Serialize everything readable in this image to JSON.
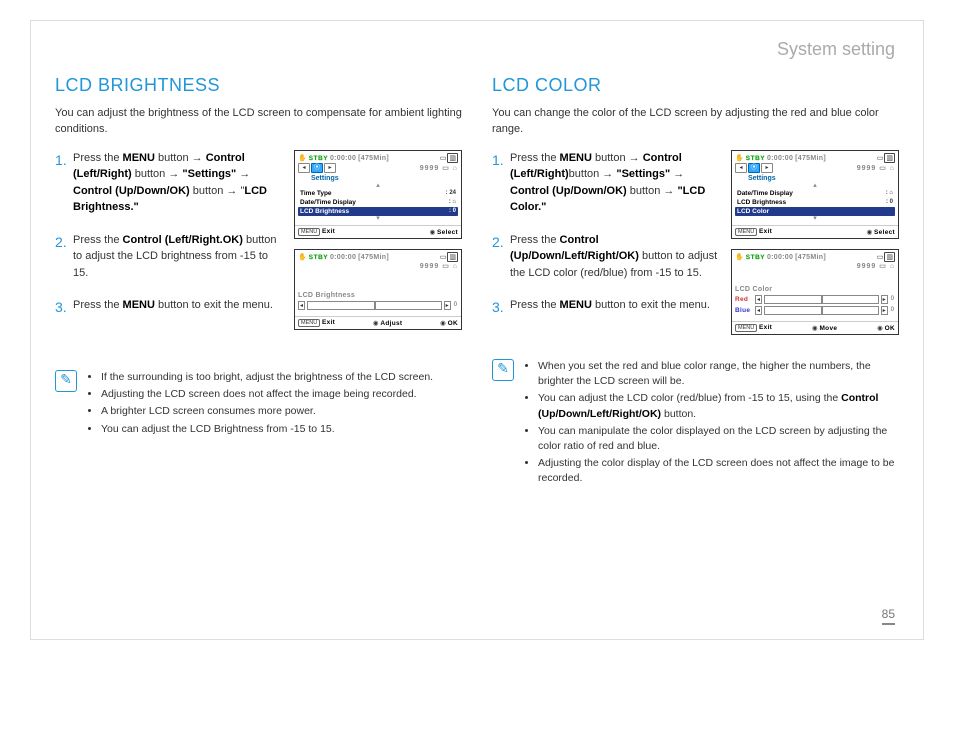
{
  "header": "System setting",
  "pageNumber": "85",
  "left": {
    "title": "LCD BRIGHTNESS",
    "intro": "You can adjust the brightness of the LCD screen to compensate for ambient lighting conditions.",
    "step1": {
      "n": "1.",
      "pre": "Press the ",
      "b1": "MENU",
      "mid1": " button → ",
      "b2": "Control (Left/Right)",
      "mid2": " button → ",
      "q1": "\"Settings\"",
      "mid3": " → ",
      "b3": "Control (Up/Down/OK)",
      "mid4": " button → \"",
      "b4": "LCD Brightness.\"",
      "post": ""
    },
    "step2": {
      "n": "2.",
      "pre": "Press the ",
      "b1": "Control (Left/Right.OK)",
      "post": " button to adjust the LCD brightness from -15 to 15."
    },
    "step3": {
      "n": "3.",
      "pre": "Press the ",
      "b1": "MENU",
      "post": " button to exit the menu."
    },
    "notes": [
      "If the surrounding is too bright, adjust the brightness of the LCD screen.",
      "Adjusting the LCD screen does not affect the image being recorded.",
      "A brighter LCD screen consumes more power.",
      "You can adjust the LCD Brightness from -15 to 15."
    ],
    "ss1": {
      "stby": "STBY",
      "time": "0:00:00",
      "minfo": "[475Min]",
      "settings": "Settings",
      "r1": {
        "l": "Time Type",
        "v": ": 24"
      },
      "r2": {
        "l": "Date/Time Display",
        "v": ": ⌂"
      },
      "r3": {
        "l": "LCD Brightness",
        "v": ": 0"
      },
      "footMenu": "MENU",
      "footExit": "Exit",
      "footSel": "Select"
    },
    "ss2": {
      "stby": "STBY",
      "time": "0:00:00",
      "minfo": "[475Min]",
      "label": "LCD Brightness",
      "val": "0",
      "footMenu": "MENU",
      "footExit": "Exit",
      "footAdj": "Adjust",
      "footOk": "OK"
    }
  },
  "right": {
    "title": "LCD COLOR",
    "intro": "You can change the color of the LCD screen by adjusting the red and blue color range.",
    "step1": {
      "n": "1.",
      "pre": "Press the ",
      "b1": "MENU",
      "mid1": " button → ",
      "b2": "Control (Left/Right)",
      "mid2": "button → ",
      "q1": "\"Settings\"",
      "mid3": " → ",
      "b3": "Control (Up/Down/OK)",
      "mid4": " button → ",
      "q2": "\"LCD Color.\""
    },
    "step2": {
      "n": "2.",
      "pre": "Press the ",
      "b1": "Control (Up/Down/Left/Right/OK)",
      "post": " button to adjust the LCD color (red/blue) from -15 to 15."
    },
    "step3": {
      "n": "3.",
      "pre": "Press the ",
      "b1": "MENU",
      "post": " button to exit the menu."
    },
    "notes": [
      "When you set the red and blue color range, the higher the numbers, the brighter the LCD screen will be.",
      {
        "pre": "You can adjust the LCD color (red/blue) from -15 to 15, using the ",
        "b": "Control (Up/Down/Left/Right/OK)",
        "post": " button."
      },
      "You can manipulate the color displayed on the LCD screen by adjusting the color ratio of red and blue.",
      "Adjusting the color display of the LCD screen does not affect the image to be recorded."
    ],
    "ss1": {
      "stby": "STBY",
      "time": "0:00:00",
      "minfo": "[475Min]",
      "settings": "Settings",
      "r1": {
        "l": "Date/Time Display",
        "v": ": ⌂"
      },
      "r2": {
        "l": "LCD Brightness",
        "v": ": 0"
      },
      "r3": {
        "l": "LCD Color",
        "v": ""
      },
      "footMenu": "MENU",
      "footExit": "Exit",
      "footSel": "Select"
    },
    "ss2": {
      "stby": "STBY",
      "time": "0:00:00",
      "minfo": "[475Min]",
      "label": "LCD Color",
      "red": "Red",
      "redv": "0",
      "blue": "Blue",
      "bluev": "0",
      "footMenu": "MENU",
      "footExit": "Exit",
      "footMove": "Move",
      "footOk": "OK"
    }
  },
  "icons": {
    "key": "⌂",
    "9999": "9999"
  }
}
